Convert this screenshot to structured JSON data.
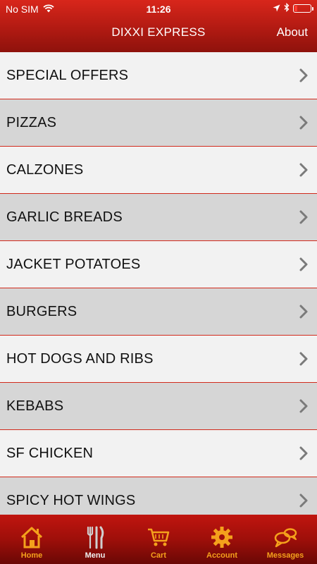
{
  "status": {
    "carrier": "No SIM",
    "time": "11:26"
  },
  "header": {
    "title": "DIXXI EXPRESS",
    "about_label": "About"
  },
  "menu": {
    "items": [
      {
        "label": "SPECIAL OFFERS"
      },
      {
        "label": "PIZZAS"
      },
      {
        "label": "CALZONES"
      },
      {
        "label": "GARLIC BREADS"
      },
      {
        "label": "JACKET POTATOES"
      },
      {
        "label": "BURGERS"
      },
      {
        "label": "HOT DOGS AND RIBS"
      },
      {
        "label": "KEBABS"
      },
      {
        "label": "SF CHICKEN"
      },
      {
        "label": "SPICY HOT WINGS"
      }
    ]
  },
  "tabbar": {
    "tabs": [
      {
        "label": "Home",
        "icon": "home-icon"
      },
      {
        "label": "Menu",
        "icon": "cutlery-icon"
      },
      {
        "label": "Cart",
        "icon": "cart-icon"
      },
      {
        "label": "Account",
        "icon": "gear-icon"
      },
      {
        "label": "Messages",
        "icon": "chat-bubbles-icon"
      }
    ]
  },
  "colors": {
    "header_red": "#b11a12",
    "divider_red": "#d12a1c",
    "tab_label_orange": "#f4a11c"
  }
}
